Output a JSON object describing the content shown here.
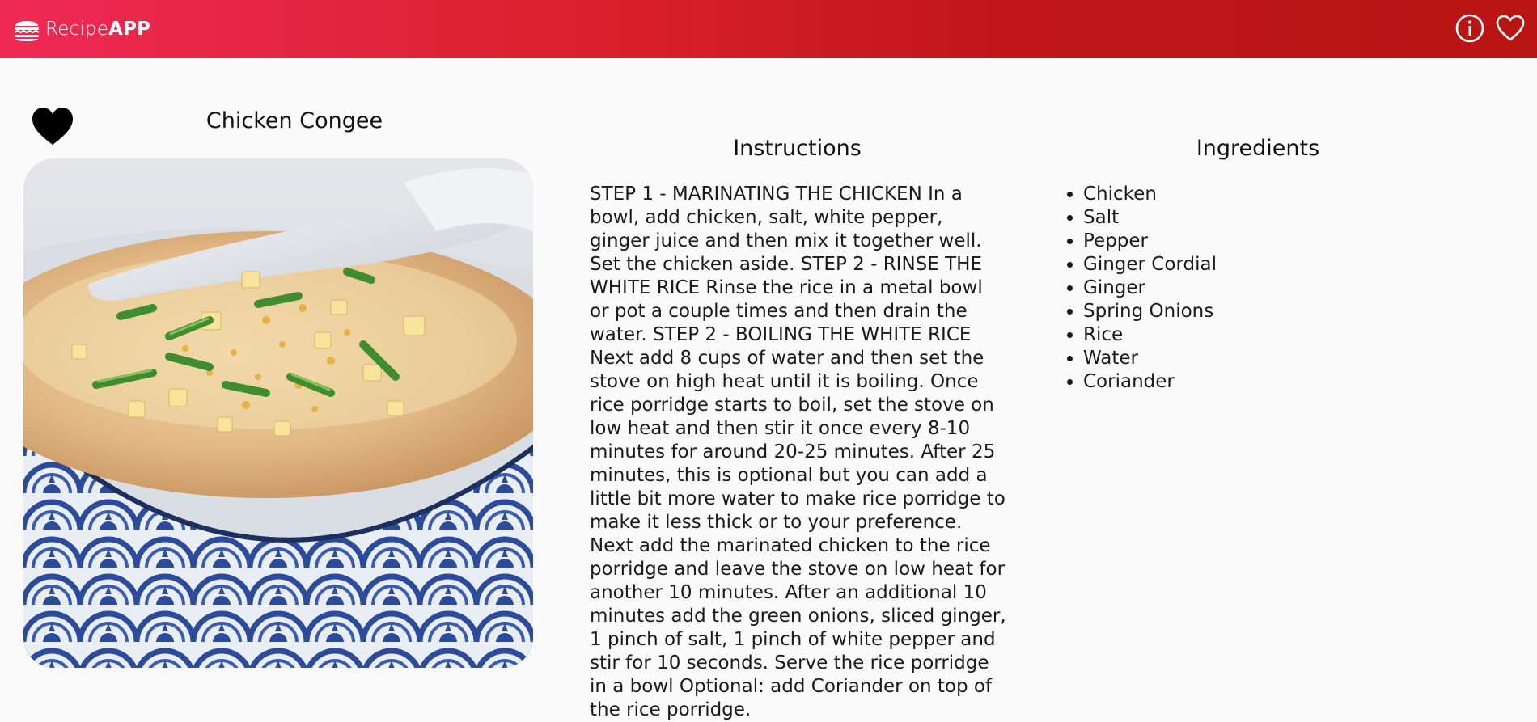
{
  "app": {
    "brand_light": "Recipe",
    "brand_bold": "APP",
    "brand_icon": "burger-icon",
    "info_icon": "info-icon",
    "favorites_icon": "heart-outline-icon"
  },
  "colors": {
    "header_start": "#ee2a55",
    "header_end": "#b91414",
    "background": "#fafafa"
  },
  "recipe": {
    "title": "Chicken Congee",
    "favorite_icon": "heart-filled-icon",
    "photo_description_icon": "congee-bowl-photo",
    "instructions_heading": "Instructions",
    "instructions_text": "STEP 1 - MARINATING THE CHICKEN In a bowl, add chicken, salt, white pepper, ginger juice and then mix it together well. Set the chicken aside. STEP 2 - RINSE THE WHITE RICE Rinse the rice in a metal bowl or pot a couple times and then drain the water. STEP 2 - BOILING THE WHITE RICE Next add 8 cups of water and then set the stove on high heat until it is boiling. Once rice porridge starts to boil, set the stove on low heat and then stir it once every 8-10 minutes for around 20-25 minutes. After 25 minutes, this is optional but you can add a little bit more water to make rice porridge to make it less thick or to your preference. Next add the marinated chicken to the rice porridge and leave the stove on low heat for another 10 minutes. After an additional 10 minutes add the green onions, sliced ginger, 1 pinch of salt, 1 pinch of white pepper and stir for 10 seconds. Serve the rice porridge in a bowl Optional: add Coriander on top of the rice porridge.",
    "ingredients_heading": "Ingredients",
    "ingredients": [
      "Chicken",
      "Salt",
      "Pepper",
      "Ginger Cordial",
      "Ginger",
      "Spring Onions",
      "Rice",
      "Water",
      "Coriander"
    ]
  }
}
